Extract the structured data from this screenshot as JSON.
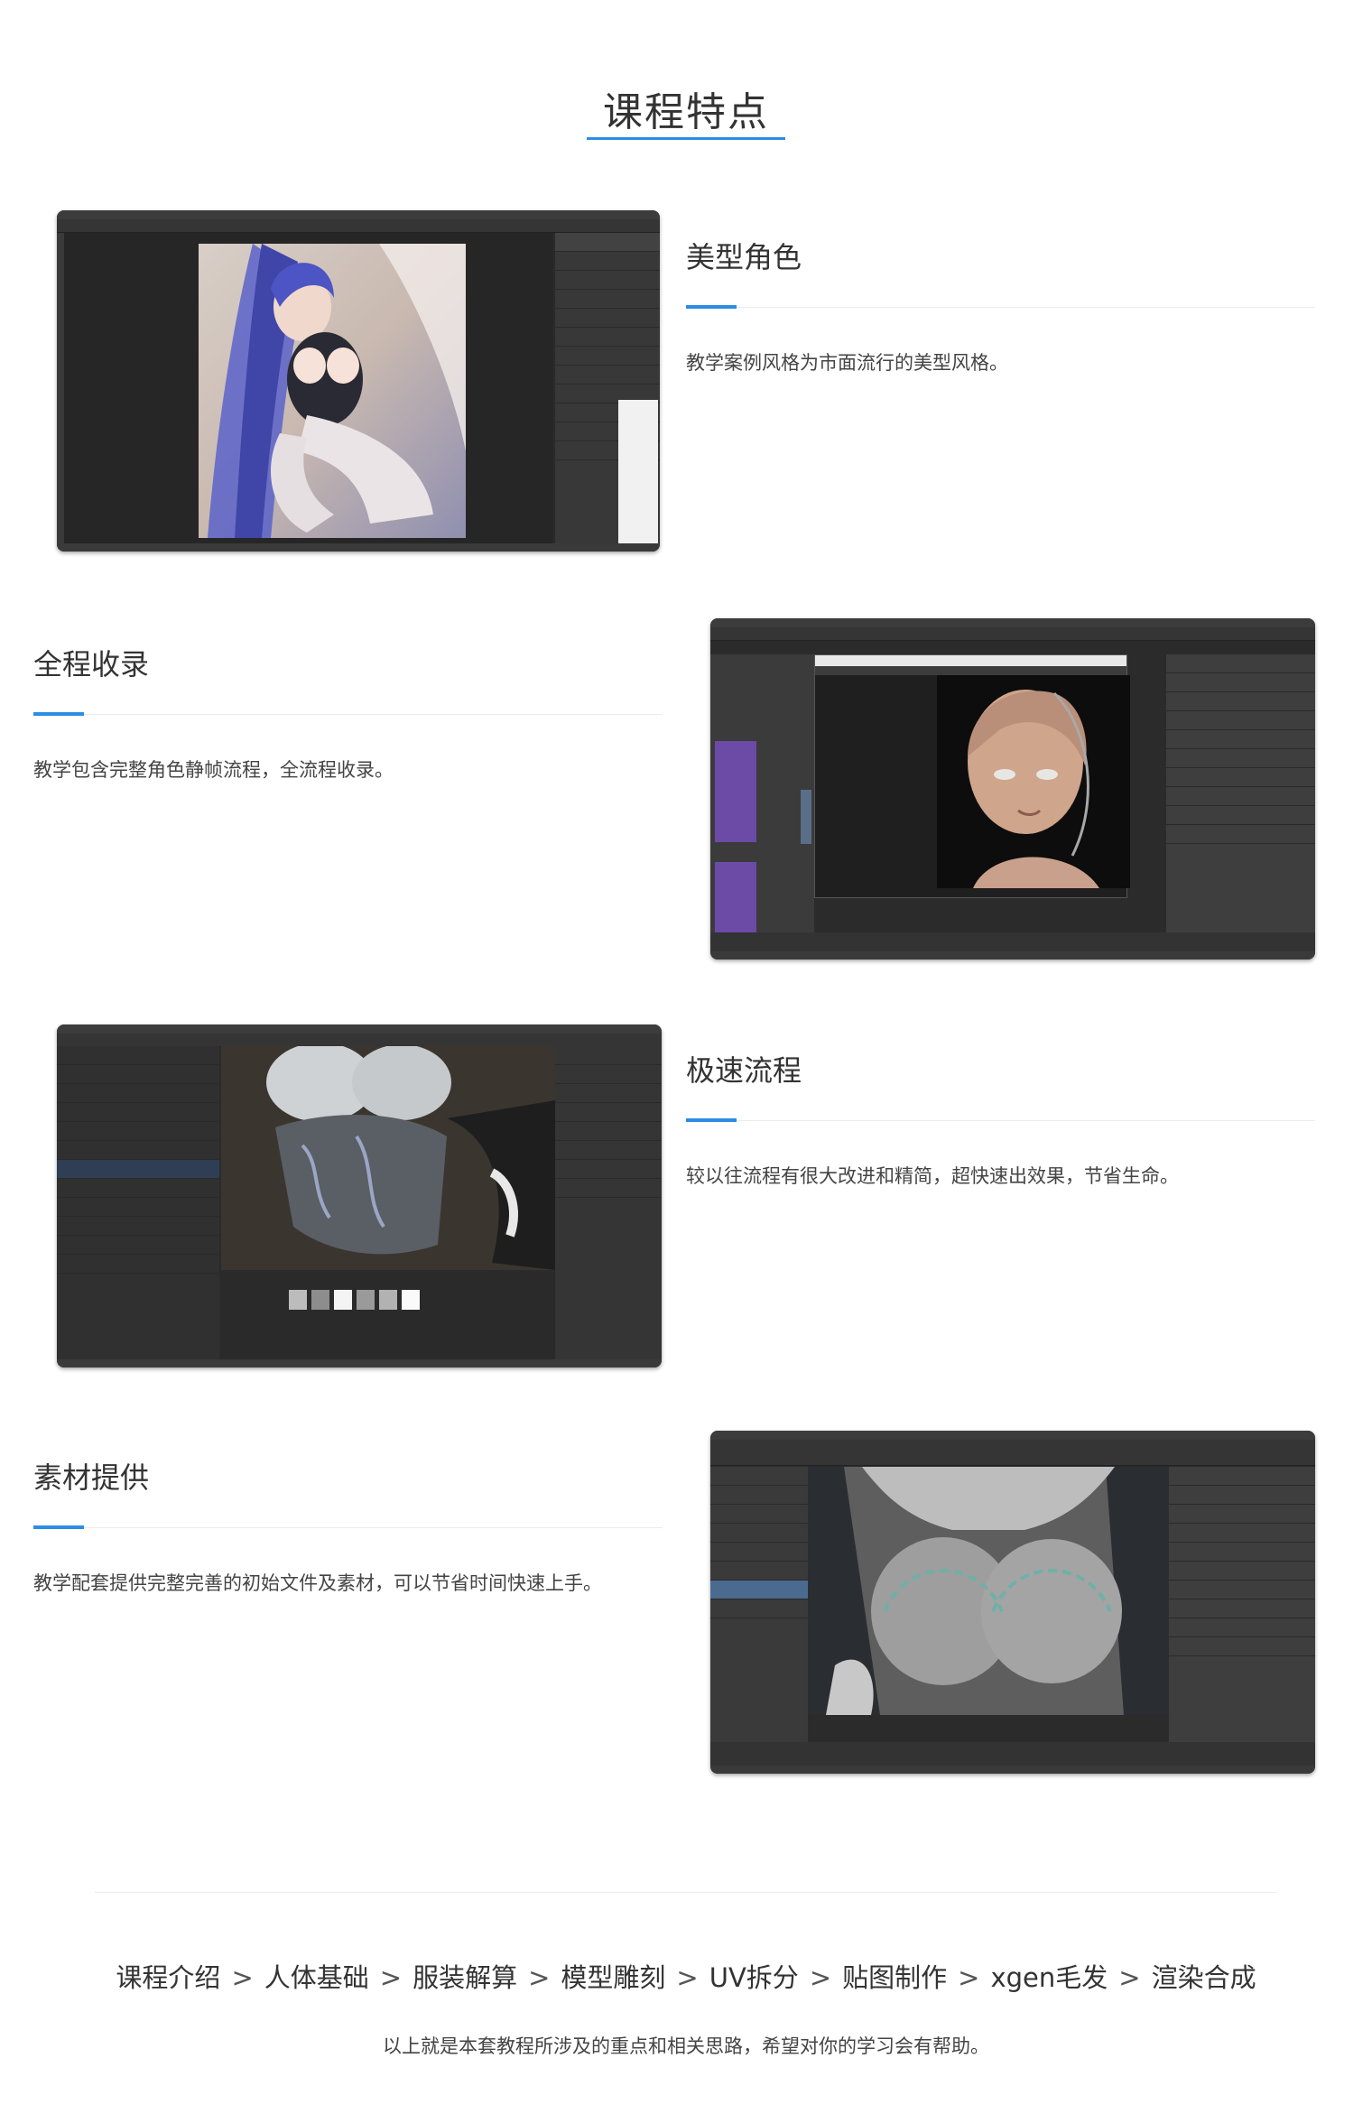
{
  "header": {
    "title": "课程特点"
  },
  "features": [
    {
      "title": "美型角色",
      "desc": "教学案例风格为市面流行的美型风格。",
      "image": "photoshop-character-screenshot"
    },
    {
      "title": "全程收录",
      "desc": "教学包含完整角色静帧流程，全流程收录。",
      "image": "maya-node-editor-render-screenshot"
    },
    {
      "title": "极速流程",
      "desc": "较以往流程有很大改进和精简，超快速出效果，节省生命。",
      "image": "substance-painter-texturing-screenshot"
    },
    {
      "title": "素材提供",
      "desc": "教学配套提供完整完善的初始文件及素材，可以节省时间快速上手。",
      "image": "maya-modeling-viewport-screenshot"
    }
  ],
  "course_path": {
    "steps": [
      "课程介绍",
      "人体基础",
      "服装解算",
      "模型雕刻",
      "UV拆分",
      "贴图制作",
      "xgen毛发",
      "渲染合成"
    ],
    "separator": ">"
  },
  "closing": "以上就是本套教程所涉及的重点和相关思路，希望对你的学习会有帮助。",
  "colors": {
    "accent": "#2b8de4",
    "text": "#333333",
    "rule": "#ececec",
    "ui_dark": "#2b2b2b"
  }
}
